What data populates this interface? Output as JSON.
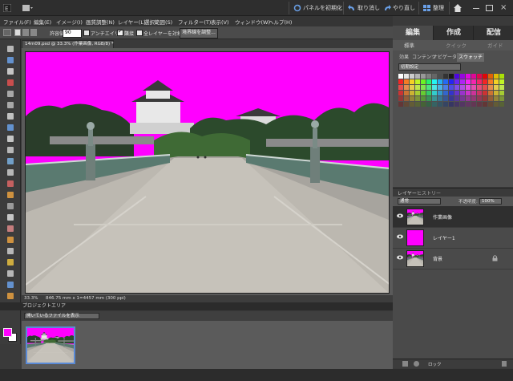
{
  "topbar": {
    "reset_panels": "パネルを初期化",
    "undo": "取り消し",
    "redo": "やり直し",
    "organizer": "整理"
  },
  "menu": [
    "ファイル(F)",
    "編集(E)",
    "イメージ(I)",
    "画質調整(N)",
    "レイヤー(L)",
    "選択範囲(S)",
    "フィルター(T)",
    "表示(V)",
    "ウィンドウ(W)",
    "ヘルプ(H)"
  ],
  "edit_tabs": {
    "edit": "編集",
    "create": "作成",
    "share": "配信"
  },
  "sub_tabs": {
    "standard": "標準",
    "quick": "クイック",
    "guided": "ガイド"
  },
  "options": {
    "tolerance_label": "許容値:",
    "tolerance_value": "90",
    "antialias": "アンチエイリアス",
    "contiguous": "隣接",
    "all_layers": "全レイヤーを対象",
    "refine_edge": "境界線を調整..."
  },
  "document": {
    "tab_title": "14m09.psd @ 33.3% (作業画像, RGB/8) *",
    "zoom": "33.3%",
    "dimensions": "846.75 mm x 1=4457 mm (300 ppi)"
  },
  "project_bin": {
    "title": "プロジェクトエリア",
    "filter": "開いているファイルを表示"
  },
  "swatches": {
    "tabs": [
      "効果",
      "コンテンツ",
      "ナビゲーター",
      "スウォッチ"
    ],
    "preset": "初期設定"
  },
  "layers_panel": {
    "tabs": [
      "レイヤー",
      "ヒストリー"
    ],
    "blend_mode": "通常",
    "opacity_label": "不透明度:",
    "opacity_value": "100%",
    "layers": [
      "作業画像",
      "レイヤー1",
      "背景"
    ]
  },
  "bottom": {
    "lock": "ロック"
  },
  "colors": {
    "magenta": "#ff00ff",
    "highlight": "#5a8ad6"
  }
}
